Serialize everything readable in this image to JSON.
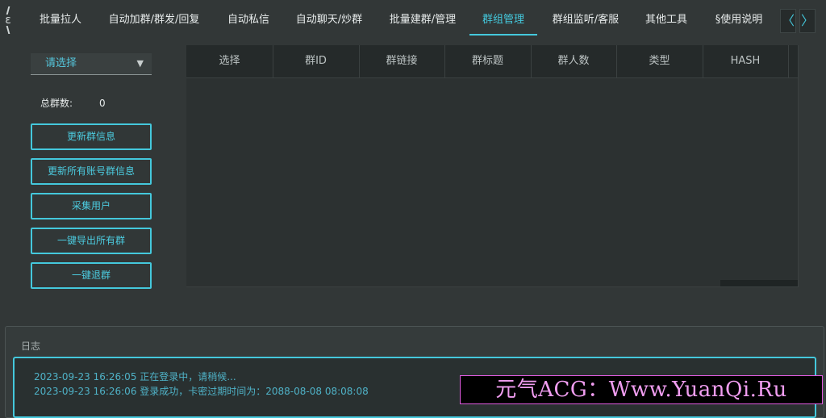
{
  "app": {
    "tabs": [
      {
        "label": "批量拉人"
      },
      {
        "label": "自动加群/群发/回复"
      },
      {
        "label": "自动私信"
      },
      {
        "label": "自动聊天/炒群"
      },
      {
        "label": "批量建群/管理"
      },
      {
        "label": "群组管理",
        "active": true
      },
      {
        "label": "群组监听/客服"
      },
      {
        "label": "其他工具"
      },
      {
        "label": "§使用说明"
      }
    ],
    "nav": {
      "prev": "〈",
      "next": "〉"
    }
  },
  "sidebar": {
    "select_value": "请选择",
    "total_label": "总群数:",
    "total_value": "0",
    "buttons": [
      "更新群信息",
      "更新所有账号群信息",
      "采集用户",
      "一键导出所有群",
      "一键退群"
    ]
  },
  "table": {
    "columns": [
      "选择",
      "群ID",
      "群链接",
      "群标题",
      "群人数",
      "类型",
      "HASH"
    ],
    "rows": []
  },
  "log": {
    "title": "日志",
    "lines": [
      "2023-09-23 16:26:05 正在登录中，请稍候...",
      "2023-09-23 16:26:06 登录成功，卡密过期时间为：2088-08-08 08:08:08"
    ]
  },
  "watermark": {
    "text": "元气ACG：Www.YuanQi.Ru"
  },
  "colors": {
    "accent": "#44c8dc",
    "background": "#323737",
    "panel": "#2c3131",
    "watermark_border": "#e05ce0"
  }
}
